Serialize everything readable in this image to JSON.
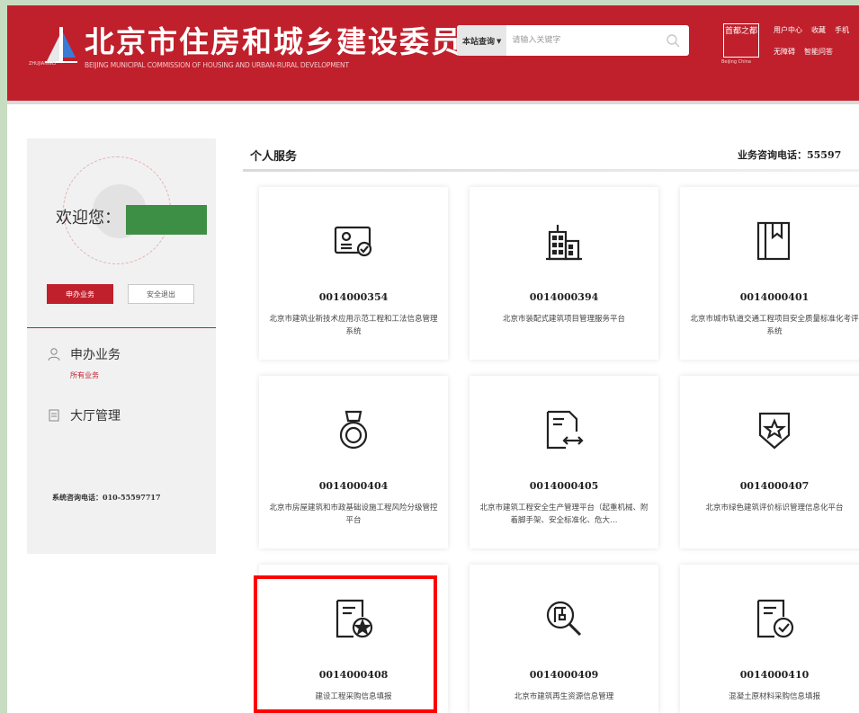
{
  "header": {
    "title": "北京市住房和城乡建设委员会",
    "subtitle": "BEIJING MUNICIPAL COMMISSION OF HOUSING AND URBAN-RURAL DEVELOPMENT",
    "logo_small": "ZHUJIANWEI",
    "search_scope": "本站查询",
    "search_placeholder": "请输入关键字",
    "seal_text": "首都之都",
    "seal_sub": "Beijing China",
    "links_row1": [
      "用户中心",
      "收藏",
      "手机"
    ],
    "links_row2": [
      "无障碍",
      "智能问答"
    ],
    "brand_color": "#c0202c"
  },
  "sidebar": {
    "welcome": "欢迎您：",
    "btn_apply": "申办业务",
    "btn_logout": "安全退出",
    "nav": [
      {
        "label": "申办业务",
        "sub": "所有业务",
        "icon": "user-icon"
      },
      {
        "label": "大厅管理",
        "icon": "document-icon"
      }
    ],
    "phone": "系统咨询电话：010-55597717"
  },
  "main": {
    "title": "个人服务",
    "phone": "业务咨询电话：55597",
    "cards": [
      {
        "code": "0014000354",
        "desc": "北京市建筑业新技术应用示范工程和工法信息管理系统",
        "icon": "id-card-check-icon"
      },
      {
        "code": "0014000394",
        "desc": "北京市装配式建筑项目管理服务平台",
        "icon": "buildings-icon"
      },
      {
        "code": "0014000401",
        "desc": "北京市城市轨道交通工程项目安全质量标准化考评系统",
        "icon": "bookmark-book-icon"
      },
      {
        "code": "0014000404",
        "desc": "北京市房屋建筑和市政基础设施工程风险分级管控平台",
        "icon": "medal-icon"
      },
      {
        "code": "0014000405",
        "desc": "北京市建筑工程安全生产管理平台（起重机械、附着脚手架、安全标准化、危大…",
        "icon": "document-arrows-icon"
      },
      {
        "code": "0014000407",
        "desc": "北京市绿色建筑评价标识管理信息化平台",
        "icon": "shield-star-icon"
      },
      {
        "code": "0014000408",
        "desc": "建设工程采购信息填报",
        "icon": "certificate-star-icon"
      },
      {
        "code": "0014000409",
        "desc": "北京市建筑再生资源信息管理",
        "icon": "magnifier-crane-icon"
      },
      {
        "code": "0014000410",
        "desc": "混凝土原材料采购信息填报",
        "icon": "document-check-icon"
      }
    ]
  }
}
